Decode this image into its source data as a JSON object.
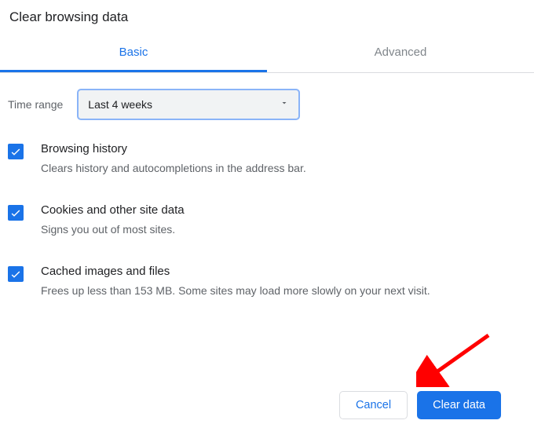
{
  "title": "Clear browsing data",
  "tabs": {
    "basic": "Basic",
    "advanced": "Advanced"
  },
  "time_range": {
    "label": "Time range",
    "value": "Last 4 weeks"
  },
  "items": [
    {
      "title": "Browsing history",
      "desc": "Clears history and autocompletions in the address bar."
    },
    {
      "title": "Cookies and other site data",
      "desc": "Signs you out of most sites."
    },
    {
      "title": "Cached images and files",
      "desc": "Frees up less than 153 MB. Some sites may load more slowly on your next visit."
    }
  ],
  "buttons": {
    "cancel": "Cancel",
    "clear": "Clear data"
  }
}
